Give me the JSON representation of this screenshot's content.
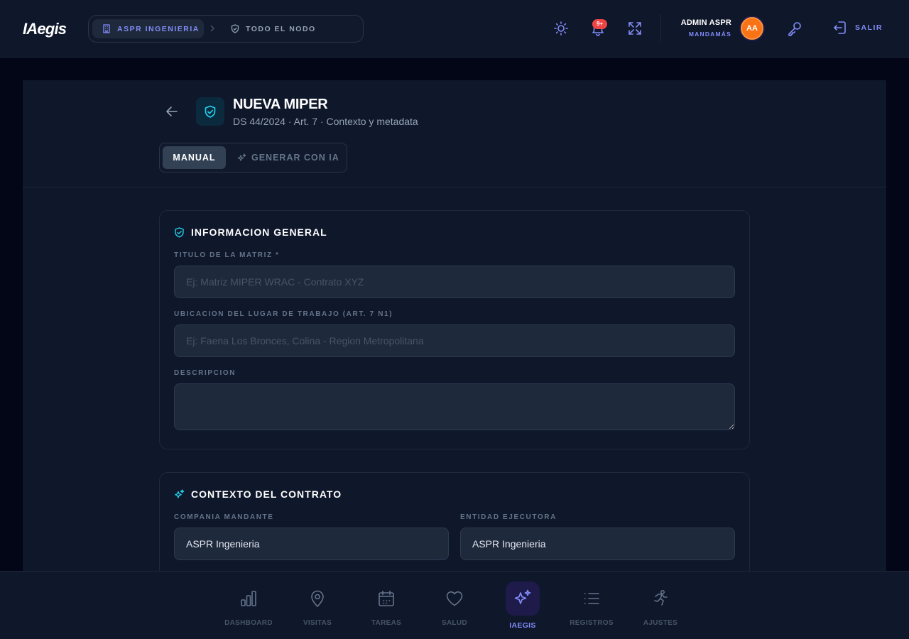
{
  "app": {
    "logo": "IAegis"
  },
  "breadcrumb": {
    "company": {
      "label": "ASPR INGENIERIA",
      "icon": "building-icon"
    },
    "scope": {
      "label": "TODO EL NODO",
      "icon": "shield-icon"
    }
  },
  "header": {
    "notifications_badge": "9+",
    "user_name": "ADMIN ASPR",
    "user_role": "MANDAMÁS",
    "avatar_initials": "AA",
    "logout_label": "SALIR"
  },
  "page": {
    "title": "NUEVA MIPER",
    "subtitle": "DS 44/2024 · Art. 7 · Contexto y metadata",
    "mode_manual": "MANUAL",
    "mode_ai": "GENERAR CON IA",
    "active_mode": "MANUAL"
  },
  "general_info": {
    "heading": "INFORMACION GENERAL",
    "title_label": "TITULO DE LA MATRIZ *",
    "title_placeholder": "Ej: Matriz MIPER WRAC - Contrato XYZ",
    "title_value": "",
    "location_label": "UBICACION DEL LUGAR DE TRABAJO (ART. 7 N1)",
    "location_placeholder": "Ej: Faena Los Bronces, Colina - Region Metropolitana",
    "location_value": "",
    "description_label": "DESCRIPCION",
    "description_value": ""
  },
  "contract_context": {
    "heading": "CONTEXTO DEL CONTRATO",
    "mandante_label": "COMPANIA MANDANTE",
    "mandante_value": "ASPR Ingenieria",
    "ejecutora_label": "ENTIDAD EJECUTORA",
    "ejecutora_value": "ASPR Ingenieria"
  },
  "bottom_nav": {
    "items": [
      {
        "label": "DASHBOARD",
        "icon": "bar-chart-icon"
      },
      {
        "label": "VISITAS",
        "icon": "map-pin-icon"
      },
      {
        "label": "TAREAS",
        "icon": "calendar-icon"
      },
      {
        "label": "SALUD",
        "icon": "heart-icon"
      },
      {
        "label": "IAEGIS",
        "icon": "sparkles-icon"
      },
      {
        "label": "REGISTROS",
        "icon": "list-icon"
      },
      {
        "label": "AJUSTES",
        "icon": "runner-icon"
      }
    ],
    "active": "IAEGIS"
  },
  "colors": {
    "accent": "#818cf8",
    "cyan": "#22d3ee",
    "avatar": "#f97316",
    "badge": "#ef4444"
  }
}
